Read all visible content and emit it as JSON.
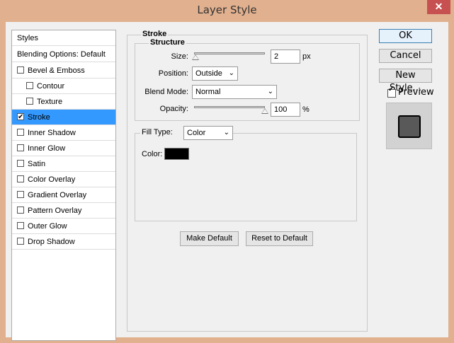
{
  "window": {
    "title": "Layer Style",
    "close_glyph": "✕"
  },
  "styles_list": {
    "header": "Styles",
    "blending": "Blending Options: Default",
    "items": [
      {
        "label": "Bevel & Emboss",
        "checked": false
      },
      {
        "label": "Contour",
        "checked": false
      },
      {
        "label": "Texture",
        "checked": false
      },
      {
        "label": "Stroke",
        "checked": true
      },
      {
        "label": "Inner Shadow",
        "checked": false
      },
      {
        "label": "Inner Glow",
        "checked": false
      },
      {
        "label": "Satin",
        "checked": false
      },
      {
        "label": "Color Overlay",
        "checked": false
      },
      {
        "label": "Gradient Overlay",
        "checked": false
      },
      {
        "label": "Pattern Overlay",
        "checked": false
      },
      {
        "label": "Outer Glow",
        "checked": false
      },
      {
        "label": "Drop Shadow",
        "checked": false
      }
    ]
  },
  "stroke": {
    "group_title": "Stroke",
    "structure_title": "Structure",
    "size_label": "Size:",
    "size_value": "2",
    "size_unit": "px",
    "position_label": "Position:",
    "position_value": "Outside",
    "blend_label": "Blend Mode:",
    "blend_value": "Normal",
    "opacity_label": "Opacity:",
    "opacity_value": "100",
    "opacity_unit": "%",
    "fill_type_label": "Fill Type:",
    "fill_type_value": "Color",
    "color_label": "Color:",
    "color_value": "#000000",
    "make_default": "Make Default",
    "reset_default": "Reset to Default"
  },
  "right": {
    "ok": "OK",
    "cancel": "Cancel",
    "new_style": "New Style...",
    "preview_label": "Preview",
    "preview_checked": true
  }
}
